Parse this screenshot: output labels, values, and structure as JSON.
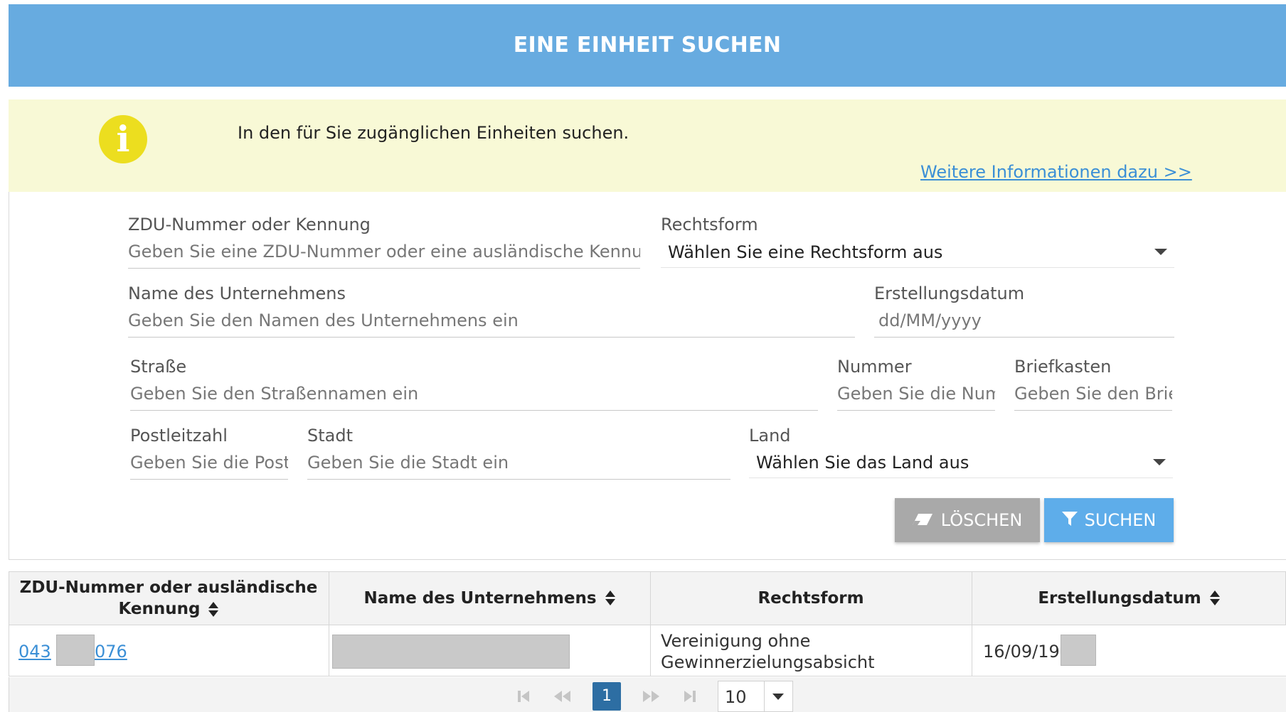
{
  "header": {
    "title": "EINE EINHEIT SUCHEN"
  },
  "info": {
    "text": "In den für Sie zugänglichen Einheiten suchen.",
    "link": "Weitere Informationen dazu >>",
    "icon": "info-icon"
  },
  "form": {
    "zdu": {
      "label": "ZDU-Nummer oder Kennung",
      "placeholder": "Geben Sie eine ZDU-Nummer oder eine ausländische Kennung ei"
    },
    "rechtsform": {
      "label": "Rechtsform",
      "value": "Wählen Sie eine Rechtsform aus"
    },
    "name": {
      "label": "Name des Unternehmens",
      "placeholder": "Geben Sie den Namen des Unternehmens ein"
    },
    "datum": {
      "label": "Erstellungsdatum",
      "placeholder": "dd/MM/yyyy"
    },
    "strasse": {
      "label": "Straße",
      "placeholder": "Geben Sie den Straßennamen ein"
    },
    "nummer": {
      "label": "Nummer",
      "placeholder": "Geben Sie die Numn"
    },
    "briefkasten": {
      "label": "Briefkasten",
      "placeholder": "Geben Sie den Brief"
    },
    "plz": {
      "label": "Postleitzahl",
      "placeholder": "Geben Sie die Postle"
    },
    "stadt": {
      "label": "Stadt",
      "placeholder": "Geben Sie die Stadt ein"
    },
    "land": {
      "label": "Land",
      "value": "Wählen Sie das Land aus"
    }
  },
  "buttons": {
    "clear": "LÖSCHEN",
    "search": "SUCHEN"
  },
  "table": {
    "headers": [
      "ZDU-Nummer oder ausländische",
      "Kennung",
      "Name des Unternehmens",
      "Rechtsform",
      "Erstellungsdatum"
    ],
    "row": {
      "zdu_start": "043",
      "zdu_end": "076",
      "rechtsform_line1": "Vereinigung ohne",
      "rechtsform_line2": "Gewinnerzielungsabsicht",
      "datum": "16/09/19"
    }
  },
  "pagination": {
    "current": "1",
    "page_size": "10"
  },
  "colors": {
    "header": "#67abe0",
    "banner": "#f8f9d6",
    "info_icon": "#ecde1f",
    "primary": "#5eadea",
    "current_page": "#2d6ea3"
  }
}
